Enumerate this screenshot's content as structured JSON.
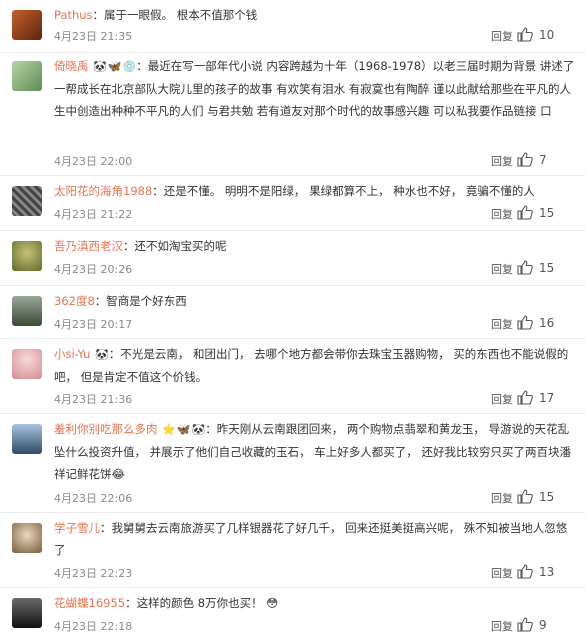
{
  "comments": [
    {
      "username": "Pathus",
      "separator": "：",
      "text": "属于一眼假。 根本不值那个钱",
      "time": "4月23日 21:35",
      "reply_label": "回复",
      "likes": "10",
      "badges": [],
      "avatar_color": "#8a3a1a"
    },
    {
      "username": "倚晓禹",
      "separator": "：",
      "text": "最近在写一部年代小说 内容跨越为十年（1968-1978）以老三届时期为背景 讲述了一帮成长在北京部队大院儿里的孩子的故事 有欢笑有泪水 有寂寞也有陶醉 谨以此献给那些在平凡的人生中创造出种种不平凡的人们 与君共勉 若有道友对那个时代的故事感兴趣 可以私我要作品链接 口",
      "time": "4月23日 22:00",
      "reply_label": "回复",
      "likes": "7",
      "badges": [
        "🐼",
        "🦋",
        "💿"
      ],
      "avatar_color": "#7aa36a"
    },
    {
      "username": "太阳花的海角1988",
      "separator": "：",
      "text": "还是不懂。 明明不是阳绿， 果绿都算不上， 种水也不好， 竟骗不懂的人",
      "time": "4月23日 21:22",
      "reply_label": "回复",
      "likes": "15",
      "badges": [],
      "avatar_color": "#555555"
    },
    {
      "username": "吾乃滇西老汉",
      "separator": "：",
      "text": "还不如淘宝买的呢",
      "time": "4月23日 20:26",
      "reply_label": "回复",
      "likes": "15",
      "badges": [],
      "avatar_color": "#6b7a3a"
    },
    {
      "username": "362度8",
      "separator": "：",
      "text": "智商是个好东西",
      "time": "4月23日 20:17",
      "reply_label": "回复",
      "likes": "16",
      "badges": [],
      "avatar_color": "#4a5a44"
    },
    {
      "username": "小si-Yu",
      "separator": "：",
      "text": "不光是云南， 和团出门， 去哪个地方都会带你去珠宝玉器购物， 买的东西也不能说假的吧， 但是肯定不值这个价钱。",
      "time": "4月23日 21:36",
      "reply_label": "回复",
      "likes": "17",
      "badges": [
        "🐼"
      ],
      "avatar_color": "#e7b0b5"
    },
    {
      "username": "羞利你别吃那么多肉",
      "separator": "：",
      "text": "昨天刚从云南跟团回来， 两个购物点翡翠和黄龙玉， 导游说的天花乱坠什么投资升值， 并展示了他们自己收藏的玉石， 车上好多人都买了， 还好我比较穷只买了两百块潘祥记鲜花饼😂",
      "time": "4月23日 22:06",
      "reply_label": "回复",
      "likes": "15",
      "badges": [
        "⭐",
        "🦋",
        "🐼"
      ],
      "avatar_color": "#3c5a7a"
    },
    {
      "username": "学子雪儿",
      "separator": "：",
      "text": "我舅舅去云南旅游买了几样银器花了好几千， 回来还挺美挺高兴呢， 殊不知被当地人忽悠了",
      "time": "4月23日 22:23",
      "reply_label": "回复",
      "likes": "13",
      "badges": [],
      "avatar_color": "#b49a7a"
    },
    {
      "username": "花蝴蝶16955",
      "separator": "：",
      "text": "这样的颜色 8万你也买！ 😳",
      "time": "4月23日 22:18",
      "reply_label": "回复",
      "likes": "9",
      "badges": [],
      "avatar_color": "#2a2a2a"
    }
  ],
  "colors": {
    "username": "#eb7350",
    "meta": "#8a8a8a",
    "divider": "#ececec"
  }
}
